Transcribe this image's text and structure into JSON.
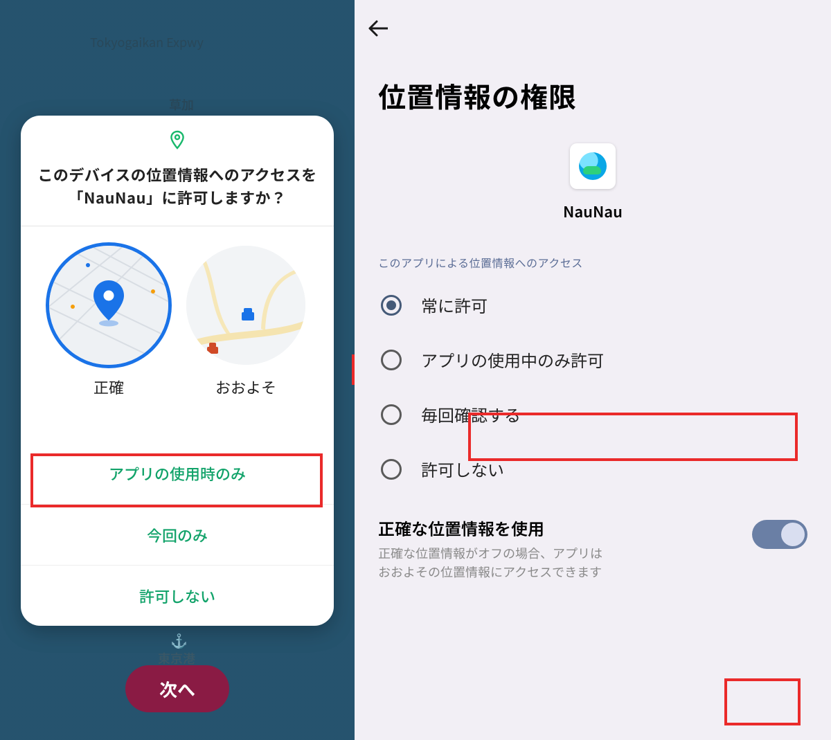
{
  "left": {
    "mapLabels": {
      "expwy": "Tokyogaikan Expwy",
      "soka": "草加",
      "port": "東京港"
    },
    "dialog": {
      "title": "このデバイスの位置情報へのアクセスを「NauNau」に許可しますか？",
      "precise": "正確",
      "approx": "おおよそ",
      "actions": {
        "whilст": "アプリの使用時のみ",
        "once": "今回のみ",
        "deny": "許可しない"
      }
    },
    "nextBtn": "次へ"
  },
  "right": {
    "title": "位置情報の権限",
    "appName": "NauNau",
    "sectionLabel": "このアプリによる位置情報へのアクセス",
    "options": {
      "always": "常に許可",
      "whileUsing": "アプリの使用中のみ許可",
      "askEvery": "毎回確認する",
      "deny": "許可しない"
    },
    "precise": {
      "title": "正確な位置情報を使用",
      "desc": "正確な位置情報がオフの場合、アプリはおおよその位置情報にアクセスできます"
    }
  }
}
